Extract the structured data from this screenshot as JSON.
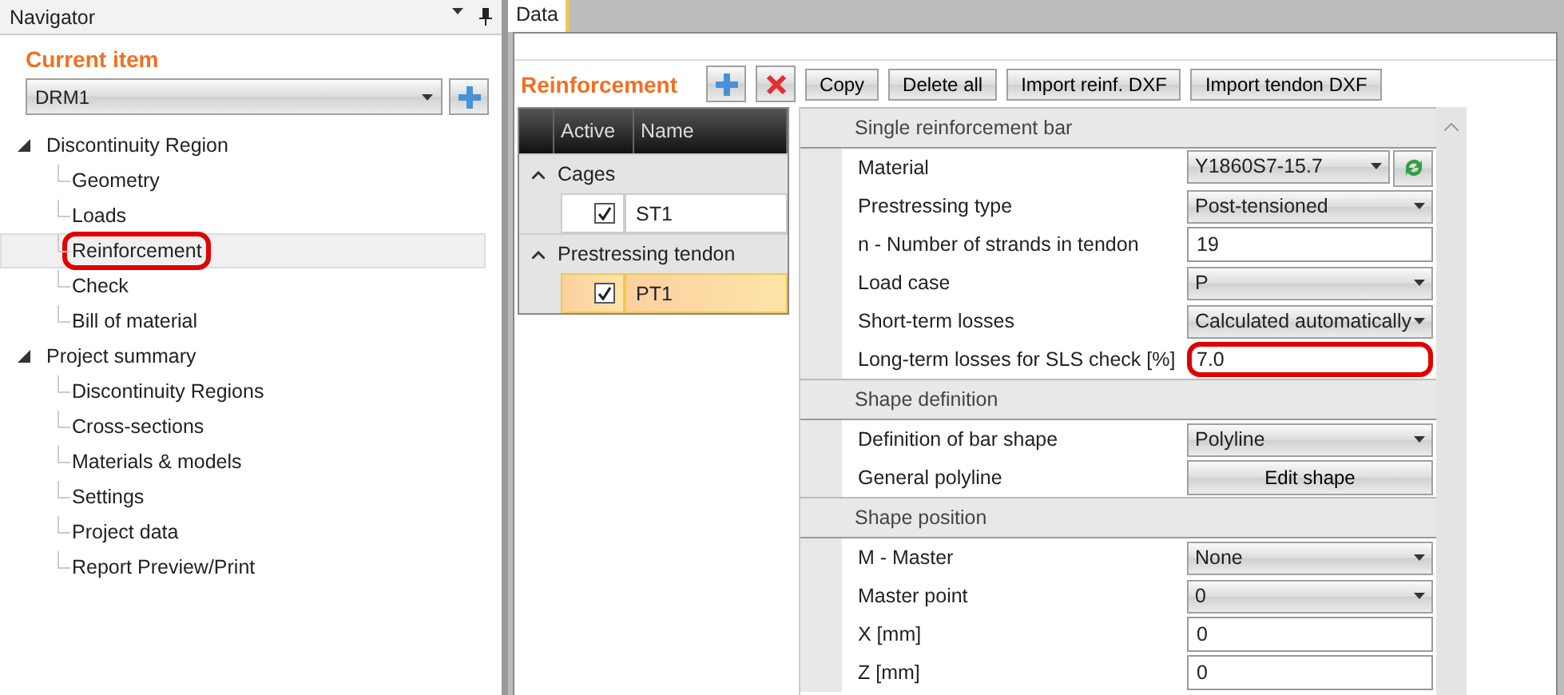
{
  "navigator": {
    "title": "Navigator",
    "section_title": "Current item",
    "current_item": "DRM1",
    "tree": [
      {
        "label": "Discontinuity Region",
        "expanded": true,
        "children": [
          {
            "label": "Geometry",
            "selected": false,
            "highlighted": false
          },
          {
            "label": "Loads",
            "selected": false,
            "highlighted": false
          },
          {
            "label": "Reinforcement",
            "selected": true,
            "highlighted": true
          },
          {
            "label": "Check",
            "selected": false,
            "highlighted": false
          },
          {
            "label": "Bill of material",
            "selected": false,
            "highlighted": false
          }
        ]
      },
      {
        "label": "Project summary",
        "expanded": true,
        "children": [
          {
            "label": "Discontinuity Regions",
            "selected": false,
            "highlighted": false
          },
          {
            "label": "Cross-sections",
            "selected": false,
            "highlighted": false
          },
          {
            "label": "Materials & models",
            "selected": false,
            "highlighted": false
          },
          {
            "label": "Settings",
            "selected": false,
            "highlighted": false
          },
          {
            "label": "Project data",
            "selected": false,
            "highlighted": false
          },
          {
            "label": "Report Preview/Print",
            "selected": false,
            "highlighted": false
          }
        ]
      }
    ]
  },
  "tabs": [
    {
      "label": "Data",
      "selected": true
    }
  ],
  "reinforcement": {
    "title": "Reinforcement",
    "buttons": [
      "Copy",
      "Delete all",
      "Import reinf. DXF",
      "Import tendon DXF"
    ],
    "table": {
      "columns": [
        "Active",
        "Name"
      ],
      "groups": [
        {
          "label": "Cages",
          "expanded": true,
          "rows": [
            {
              "active": true,
              "name": "ST1",
              "selected": false
            }
          ]
        },
        {
          "label": "Prestressing tendon",
          "expanded": true,
          "rows": [
            {
              "active": true,
              "name": "PT1",
              "selected": true
            }
          ]
        }
      ]
    }
  },
  "properties": [
    {
      "title": "Single reinforcement bar",
      "rows": [
        {
          "kind": "dropdown",
          "label": "Material",
          "value": "Y1860S7-15.7",
          "refresh": true,
          "highlighted": false
        },
        {
          "kind": "dropdown",
          "label": "Prestressing type",
          "value": "Post-tensioned",
          "highlighted": false
        },
        {
          "kind": "text",
          "label": "n - Number of strands in tendon",
          "value": "19",
          "highlighted": false
        },
        {
          "kind": "dropdown",
          "label": "Load case",
          "value": "P",
          "highlighted": false
        },
        {
          "kind": "dropdown",
          "label": "Short-term losses",
          "value": "Calculated automatically",
          "highlighted": false
        },
        {
          "kind": "text",
          "label": "Long-term losses for SLS check [%]",
          "value": "7.0",
          "highlighted": true
        }
      ]
    },
    {
      "title": "Shape definition",
      "rows": [
        {
          "kind": "dropdown",
          "label": "Definition of bar shape",
          "value": "Polyline",
          "highlighted": false
        },
        {
          "kind": "button",
          "label": "General polyline",
          "value": "Edit shape",
          "highlighted": false
        }
      ]
    },
    {
      "title": "Shape position",
      "rows": [
        {
          "kind": "dropdown",
          "label": "M - Master",
          "value": "None",
          "highlighted": false
        },
        {
          "kind": "dropdown",
          "label": "Master point",
          "value": "0",
          "highlighted": false
        },
        {
          "kind": "text",
          "label": "X [mm]",
          "value": "0",
          "highlighted": false
        },
        {
          "kind": "text",
          "label": "Z [mm]",
          "value": "0",
          "highlighted": false
        }
      ]
    }
  ]
}
